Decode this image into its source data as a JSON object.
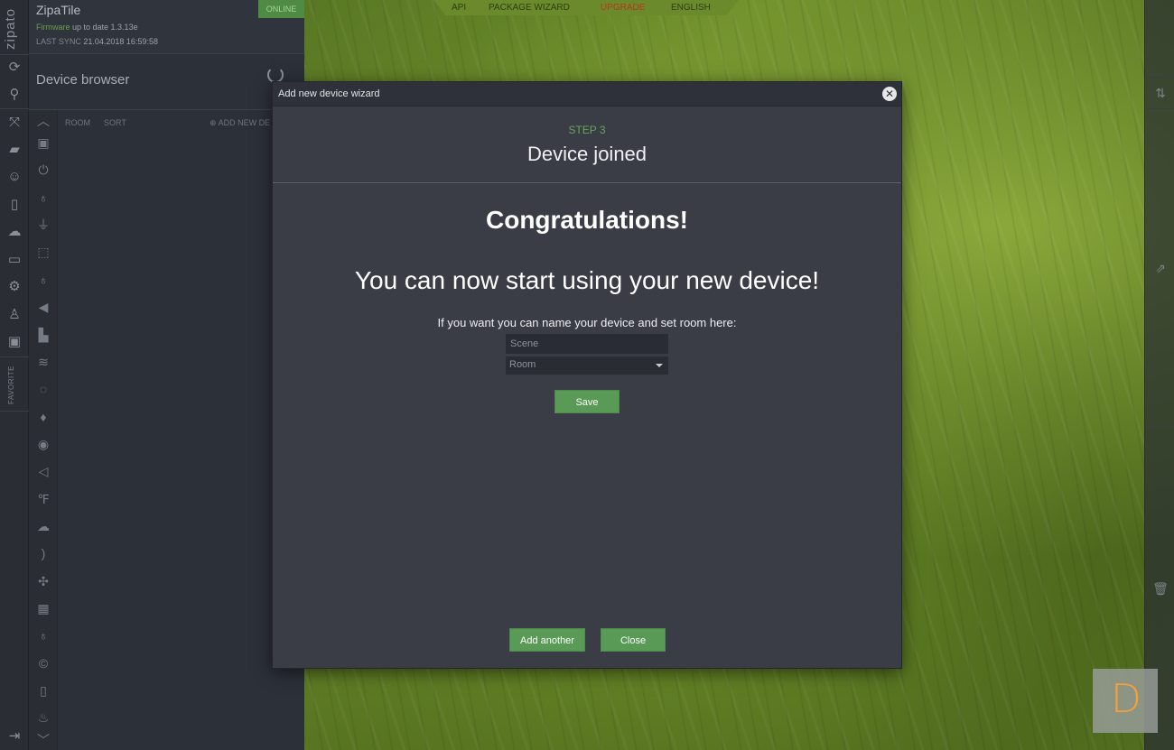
{
  "app": {
    "name": "ZipaTile",
    "logo": "zipato",
    "status": "ONLINE",
    "firmware_label": "Firmware",
    "firmware_status": "up to date 1.3.13e",
    "last_sync_label": "LAST SYNC",
    "last_sync_value": "21.04.2018 16:59:58"
  },
  "top_menu": {
    "api": "API",
    "package_wizard": "PACKAGE WIZARD",
    "upgrade": "UPGRADE",
    "language": "ENGLISH"
  },
  "device_browser": {
    "title": "Device browser",
    "room_label": "ROOM",
    "sort_label": "SORT",
    "add_new_label": "ADD NEW DE"
  },
  "sidebar": {
    "favorite_label": "FAVORITE"
  },
  "modal": {
    "title": "Add new device wizard",
    "close_symbol": "✕",
    "step_label": "STEP 3",
    "step_title": "Device joined",
    "congratulations": "Congratulations!",
    "message": "You can now start using your new device!",
    "hint": "If you want you can name your device and set room here:",
    "name_value": "Scene",
    "room_value": "Room",
    "save_label": "Save",
    "add_another_label": "Add another",
    "close_label": "Close"
  },
  "watermark": {
    "letter": "D"
  },
  "colors": {
    "accent_green": "#5a9a57",
    "step_green": "#6aa35b",
    "upgrade_red": "#b53a1c",
    "modal_bg": "#3a3d46"
  }
}
